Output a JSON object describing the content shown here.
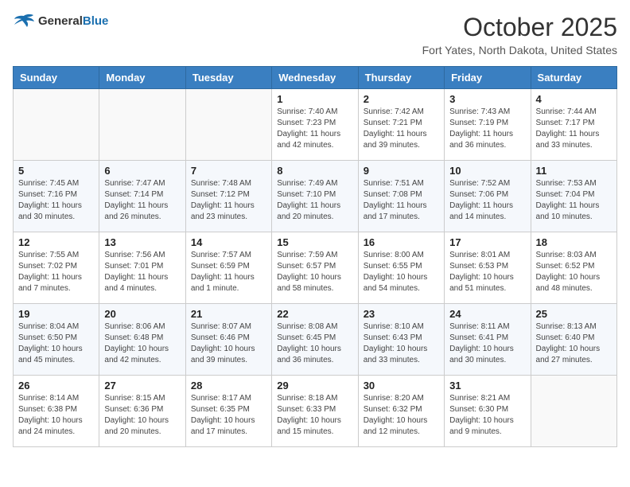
{
  "header": {
    "logo_general": "General",
    "logo_blue": "Blue",
    "title": "October 2025",
    "location": "Fort Yates, North Dakota, United States"
  },
  "days_of_week": [
    "Sunday",
    "Monday",
    "Tuesday",
    "Wednesday",
    "Thursday",
    "Friday",
    "Saturday"
  ],
  "weeks": [
    [
      {
        "day": "",
        "info": ""
      },
      {
        "day": "",
        "info": ""
      },
      {
        "day": "",
        "info": ""
      },
      {
        "day": "1",
        "info": "Sunrise: 7:40 AM\nSunset: 7:23 PM\nDaylight: 11 hours and 42 minutes."
      },
      {
        "day": "2",
        "info": "Sunrise: 7:42 AM\nSunset: 7:21 PM\nDaylight: 11 hours and 39 minutes."
      },
      {
        "day": "3",
        "info": "Sunrise: 7:43 AM\nSunset: 7:19 PM\nDaylight: 11 hours and 36 minutes."
      },
      {
        "day": "4",
        "info": "Sunrise: 7:44 AM\nSunset: 7:17 PM\nDaylight: 11 hours and 33 minutes."
      }
    ],
    [
      {
        "day": "5",
        "info": "Sunrise: 7:45 AM\nSunset: 7:16 PM\nDaylight: 11 hours and 30 minutes."
      },
      {
        "day": "6",
        "info": "Sunrise: 7:47 AM\nSunset: 7:14 PM\nDaylight: 11 hours and 26 minutes."
      },
      {
        "day": "7",
        "info": "Sunrise: 7:48 AM\nSunset: 7:12 PM\nDaylight: 11 hours and 23 minutes."
      },
      {
        "day": "8",
        "info": "Sunrise: 7:49 AM\nSunset: 7:10 PM\nDaylight: 11 hours and 20 minutes."
      },
      {
        "day": "9",
        "info": "Sunrise: 7:51 AM\nSunset: 7:08 PM\nDaylight: 11 hours and 17 minutes."
      },
      {
        "day": "10",
        "info": "Sunrise: 7:52 AM\nSunset: 7:06 PM\nDaylight: 11 hours and 14 minutes."
      },
      {
        "day": "11",
        "info": "Sunrise: 7:53 AM\nSunset: 7:04 PM\nDaylight: 11 hours and 10 minutes."
      }
    ],
    [
      {
        "day": "12",
        "info": "Sunrise: 7:55 AM\nSunset: 7:02 PM\nDaylight: 11 hours and 7 minutes."
      },
      {
        "day": "13",
        "info": "Sunrise: 7:56 AM\nSunset: 7:01 PM\nDaylight: 11 hours and 4 minutes."
      },
      {
        "day": "14",
        "info": "Sunrise: 7:57 AM\nSunset: 6:59 PM\nDaylight: 11 hours and 1 minute."
      },
      {
        "day": "15",
        "info": "Sunrise: 7:59 AM\nSunset: 6:57 PM\nDaylight: 10 hours and 58 minutes."
      },
      {
        "day": "16",
        "info": "Sunrise: 8:00 AM\nSunset: 6:55 PM\nDaylight: 10 hours and 54 minutes."
      },
      {
        "day": "17",
        "info": "Sunrise: 8:01 AM\nSunset: 6:53 PM\nDaylight: 10 hours and 51 minutes."
      },
      {
        "day": "18",
        "info": "Sunrise: 8:03 AM\nSunset: 6:52 PM\nDaylight: 10 hours and 48 minutes."
      }
    ],
    [
      {
        "day": "19",
        "info": "Sunrise: 8:04 AM\nSunset: 6:50 PM\nDaylight: 10 hours and 45 minutes."
      },
      {
        "day": "20",
        "info": "Sunrise: 8:06 AM\nSunset: 6:48 PM\nDaylight: 10 hours and 42 minutes."
      },
      {
        "day": "21",
        "info": "Sunrise: 8:07 AM\nSunset: 6:46 PM\nDaylight: 10 hours and 39 minutes."
      },
      {
        "day": "22",
        "info": "Sunrise: 8:08 AM\nSunset: 6:45 PM\nDaylight: 10 hours and 36 minutes."
      },
      {
        "day": "23",
        "info": "Sunrise: 8:10 AM\nSunset: 6:43 PM\nDaylight: 10 hours and 33 minutes."
      },
      {
        "day": "24",
        "info": "Sunrise: 8:11 AM\nSunset: 6:41 PM\nDaylight: 10 hours and 30 minutes."
      },
      {
        "day": "25",
        "info": "Sunrise: 8:13 AM\nSunset: 6:40 PM\nDaylight: 10 hours and 27 minutes."
      }
    ],
    [
      {
        "day": "26",
        "info": "Sunrise: 8:14 AM\nSunset: 6:38 PM\nDaylight: 10 hours and 24 minutes."
      },
      {
        "day": "27",
        "info": "Sunrise: 8:15 AM\nSunset: 6:36 PM\nDaylight: 10 hours and 20 minutes."
      },
      {
        "day": "28",
        "info": "Sunrise: 8:17 AM\nSunset: 6:35 PM\nDaylight: 10 hours and 17 minutes."
      },
      {
        "day": "29",
        "info": "Sunrise: 8:18 AM\nSunset: 6:33 PM\nDaylight: 10 hours and 15 minutes."
      },
      {
        "day": "30",
        "info": "Sunrise: 8:20 AM\nSunset: 6:32 PM\nDaylight: 10 hours and 12 minutes."
      },
      {
        "day": "31",
        "info": "Sunrise: 8:21 AM\nSunset: 6:30 PM\nDaylight: 10 hours and 9 minutes."
      },
      {
        "day": "",
        "info": ""
      }
    ]
  ]
}
